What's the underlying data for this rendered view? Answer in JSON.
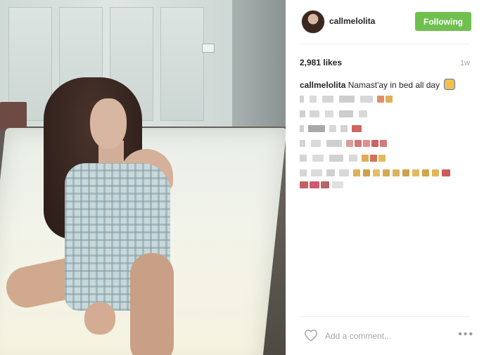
{
  "header": {
    "username": "callmelolita",
    "follow_label": "Following"
  },
  "stats": {
    "likes": "2,981 likes",
    "time_ago": "1w"
  },
  "caption": {
    "username": "callmelolita",
    "text": "Namast'ay in bed all day"
  },
  "comment": {
    "placeholder": "Add a comment..."
  },
  "icons": {
    "heart": "heart-icon",
    "more": "more-options-icon",
    "pray_emoji": "pray-emoji-icon"
  },
  "colors": {
    "follow_button": "#70c050",
    "text": "#262626",
    "muted": "#a5a7aa"
  }
}
